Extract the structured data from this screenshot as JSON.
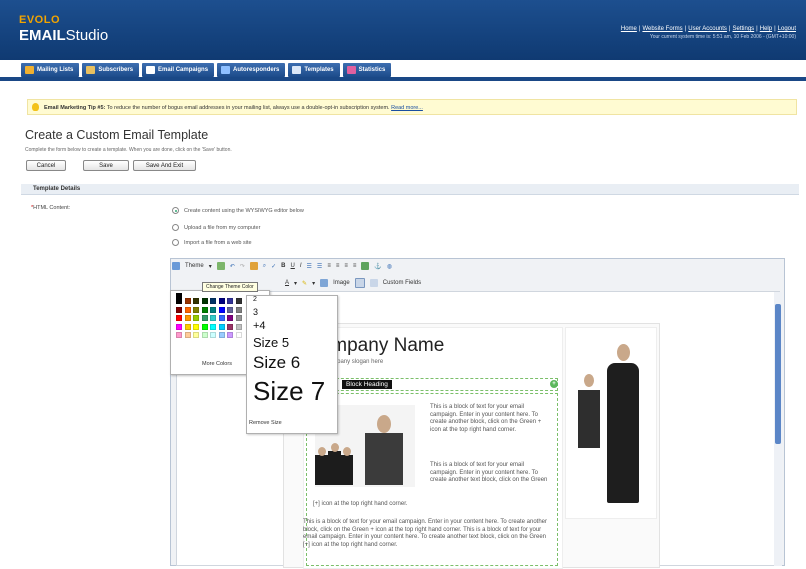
{
  "header": {
    "logo_top": "EVOLO",
    "logo_main_bold": "EMAIL",
    "logo_main_rest": "Studio",
    "links": [
      "Home",
      "Website Forms",
      "User Accounts",
      "Settings",
      "Help",
      "Logout"
    ],
    "time_note": "Your current system time is: 5:51 am, 10 Feb 2006 - (GMT+10:00)"
  },
  "tabs": [
    {
      "label": "Mailing Lists",
      "icon": "mailing-lists-icon",
      "color": "#f0b030"
    },
    {
      "label": "Subscribers",
      "icon": "subscribers-icon",
      "color": "#e8c060"
    },
    {
      "label": "Email Campaigns",
      "icon": "email-campaigns-icon",
      "color": "#ffffff"
    },
    {
      "label": "Autoresponders",
      "icon": "autoresponders-icon",
      "color": "#8fc0ff"
    },
    {
      "label": "Templates",
      "icon": "templates-icon",
      "color": "#dce8f8"
    },
    {
      "label": "Statistics",
      "icon": "statistics-icon",
      "color": "#e060a0"
    }
  ],
  "tip": {
    "bold": "Email Marketing Tip #5:",
    "text": " To reduce the number of bogus email addresses in your mailing list, always use a double-opt-in subscription system.",
    "link": "Read more..."
  },
  "page": {
    "title": "Create a Custom Email Template",
    "subtitle": "Complete the form below to create a template. When you are done, click on the 'Save' button.",
    "buttons": {
      "cancel": "Cancel",
      "save": "Save",
      "save_exit": "Save And Exit"
    }
  },
  "section": {
    "title": "Template Details",
    "field_label": "HTML Content:",
    "required_mark": "*",
    "options": [
      "Create content using the WYSIWYG editor below",
      "Upload a file from my computer",
      "Import a file from a web site"
    ]
  },
  "editor": {
    "theme_label": "Theme",
    "image_label": "Image",
    "custom_fields_label": "Custom Fields",
    "tooltip": "Change Theme Color",
    "more_colors": "More Colors",
    "remove_size": "Remove Size",
    "sizes": [
      "2",
      "3",
      "+4",
      "Size 5",
      "Size 6",
      "Size 7"
    ]
  },
  "template": {
    "company_name": "Company Name",
    "slogan": "Your company slogan here",
    "block_heading": "Block Heading",
    "block_text_1": "This is a block of text for your email campaign. Enter in your content here. To create another block, click on the Green + icon at the top right hand corner.",
    "block_text_2": "This is a block of text for your email campaign. Enter in your content here. To create another text block, click on the Green",
    "block_text_2b": "[+] icon at the top right hand corner.",
    "block_text_3": "This is a block of text for your email campaign. Enter in your content here. To create another block, click on the Green + icon at the top right hand corner. This is a block of text for your email campaign. Enter in your content here. To create another text block, click on the Green [+] icon at the top right hand corner."
  },
  "palette": {
    "rows": [
      [
        "#000000",
        "#993300",
        "#333300",
        "#003300",
        "#003366",
        "#000080",
        "#333399",
        "#333333"
      ],
      [
        "#800000",
        "#ff6600",
        "#808000",
        "#008000",
        "#008080",
        "#0000ff",
        "#666699",
        "#808080"
      ],
      [
        "#ff0000",
        "#ff9900",
        "#99cc00",
        "#339966",
        "#33cccc",
        "#3366ff",
        "#800080",
        "#969696"
      ],
      [
        "#ff00ff",
        "#ffcc00",
        "#ffff00",
        "#00ff00",
        "#00ffff",
        "#00ccff",
        "#993366",
        "#c0c0c0"
      ],
      [
        "#ff99cc",
        "#ffcc99",
        "#ffff99",
        "#ccffcc",
        "#ccffff",
        "#99ccff",
        "#cc99ff",
        "#ffffff"
      ]
    ]
  }
}
